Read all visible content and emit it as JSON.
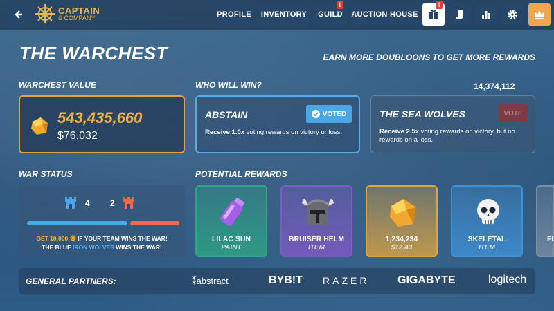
{
  "topbar": {
    "logo_line1": "CAPTAIN",
    "logo_line2": "& COMPANY",
    "nav": [
      "PROFILE",
      "INVENTORY",
      "GUILD",
      "AUCTION HOUSE"
    ],
    "alert_mark": "!",
    "icons": [
      "back-arrow-icon",
      "gift-icon",
      "scroll-icon",
      "leaderboard-icon",
      "gear-icon",
      "crown-icon"
    ]
  },
  "page": {
    "title": "THE WARCHEST",
    "subtitle": "EARN MORE DOUBLOONS TO GET MORE REWARDS"
  },
  "warchest": {
    "label": "WARCHEST VALUE",
    "value": "543,435,660",
    "usd": "$76,032"
  },
  "vote": {
    "label": "WHO WILL WIN?",
    "total": "14,374,112",
    "options": [
      {
        "name": "ABSTAIN",
        "button": "VOTED",
        "desc_bold": "Receive 1.0x",
        "desc_rest": " voting rewards on victory or loss."
      },
      {
        "name": "THE SEA WOLVES",
        "button": "VOTE",
        "desc_bold": "Receive 2.5x",
        "desc_rest": " voting rewards on victory, but no rewards on a loss."
      }
    ]
  },
  "war_status": {
    "label": "WAR STATUS",
    "blue_score": "4",
    "orange_score": "2",
    "blue_share": 0.67,
    "line1_amount": "GET 10,000",
    "line1_rest": " IF YOUR TEAM  WINS THE WAR!",
    "line2_pre": "THE BLUE ",
    "line2_team": "IRON WOLVES",
    "line2_post": " WINS THE WAR!"
  },
  "rewards": {
    "label": "POTENTIAL REWARDS",
    "items": [
      {
        "name": "LILAC SUN",
        "sub": "PAINT",
        "color": "#2ea884"
      },
      {
        "name": "BRUISER HELM",
        "sub": "ITEM",
        "color": "#8458c8"
      },
      {
        "name": "1,234,234",
        "sub": "$12.43",
        "color": "#e0a43e"
      },
      {
        "name": "SKELETAL",
        "sub": "ITEM",
        "color": "#3f92d8"
      },
      {
        "name": "FE",
        "sub": "",
        "color": "#7c8ea4"
      }
    ]
  },
  "partners": {
    "label": "GENERAL PARTNERS:",
    "names": [
      "abstract",
      "BYB!T",
      "RAZER",
      "GIGABYTE",
      "logitech"
    ]
  }
}
